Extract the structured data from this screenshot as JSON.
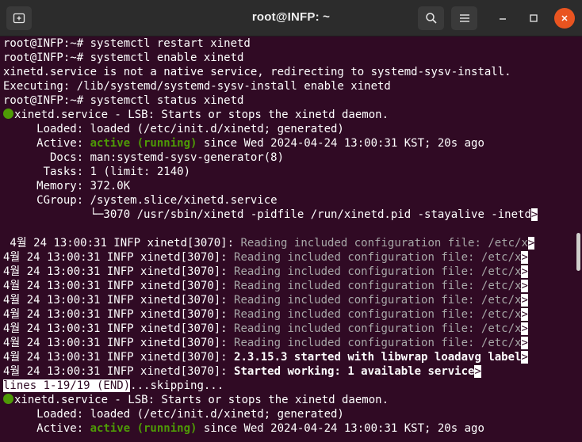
{
  "window": {
    "title": "root@INFP: ~",
    "icons": [
      "new-tab-icon",
      "search-icon",
      "hamburger-menu-icon",
      "minimize-icon",
      "maximize-icon",
      "close-icon"
    ]
  },
  "colors": {
    "terminal_bg": "#300a24",
    "active_green": "#4e9a06",
    "close_orange": "#e95420",
    "log_dim": "#a8a8a8"
  },
  "terminal": {
    "cmd1": "root@INFP:~# systemctl restart xinetd",
    "cmd2": "root@INFP:~# systemctl enable xinetd",
    "enable_msg": "xinetd.service is not a native service, redirecting to systemd-sysv-install.",
    "executing": "Executing: /lib/systemd/systemd-sysv-install enable xinetd",
    "cmd3": "root@INFP:~# systemctl status xinetd",
    "status": {
      "service_line": "xinetd.service - LSB: Starts or stops the xinetd daemon.",
      "loaded": "     Loaded: loaded (/etc/init.d/xinetd; generated)",
      "active_prefix": "     Active: ",
      "active_state": "active (running)",
      "active_suffix": " since Wed 2024-04-24 13:00:31 KST; 20s ago",
      "docs": "       Docs: man:systemd-sysv-generator(8)",
      "tasks": "      Tasks: 1 (limit: 2140)",
      "memory": "     Memory: 372.0K",
      "cgroup": "     CGroup: /system.slice/xinetd.service",
      "cgroup_proc": "             └─3070 /usr/sbin/xinetd -pidfile /run/xinetd.pid -stayalive -inetd",
      "trunc_mark": ">"
    },
    "logs": [
      {
        "prefix": " 4월 24 13:00:31 INFP xinetd[3070]: ",
        "msg": "Reading included configuration file: /etc/x",
        "style": "dim"
      },
      {
        "prefix": "4월 24 13:00:31 INFP xinetd[3070]: ",
        "msg": "Reading included configuration file: /etc/x",
        "style": "dim"
      },
      {
        "prefix": "4월 24 13:00:31 INFP xinetd[3070]: ",
        "msg": "Reading included configuration file: /etc/x",
        "style": "dim"
      },
      {
        "prefix": "4월 24 13:00:31 INFP xinetd[3070]: ",
        "msg": "Reading included configuration file: /etc/x",
        "style": "dim"
      },
      {
        "prefix": "4월 24 13:00:31 INFP xinetd[3070]: ",
        "msg": "Reading included configuration file: /etc/x",
        "style": "dim"
      },
      {
        "prefix": "4월 24 13:00:31 INFP xinetd[3070]: ",
        "msg": "Reading included configuration file: /etc/x",
        "style": "dim"
      },
      {
        "prefix": "4월 24 13:00:31 INFP xinetd[3070]: ",
        "msg": "Reading included configuration file: /etc/x",
        "style": "dim"
      },
      {
        "prefix": "4월 24 13:00:31 INFP xinetd[3070]: ",
        "msg": "Reading included configuration file: /etc/x",
        "style": "dim"
      },
      {
        "prefix": "4월 24 13:00:31 INFP xinetd[3070]: ",
        "msg": "2.3.15.3 started with libwrap loadavg label",
        "style": "bold"
      },
      {
        "prefix": "4월 24 13:00:31 INFP xinetd[3070]: ",
        "msg": "Started working: 1 available service",
        "style": "bold"
      }
    ],
    "pager_status": "lines 1-19/19 (END)",
    "skipping": "...skipping...",
    "repeat": {
      "service_line": "xinetd.service - LSB: Starts or stops the xinetd daemon.",
      "loaded": "     Loaded: loaded (/etc/init.d/xinetd; generated)",
      "active_prefix": "     Active: ",
      "active_state": "active (running)",
      "active_suffix": " since Wed 2024-04-24 13:00:31 KST; 20s ago"
    }
  }
}
